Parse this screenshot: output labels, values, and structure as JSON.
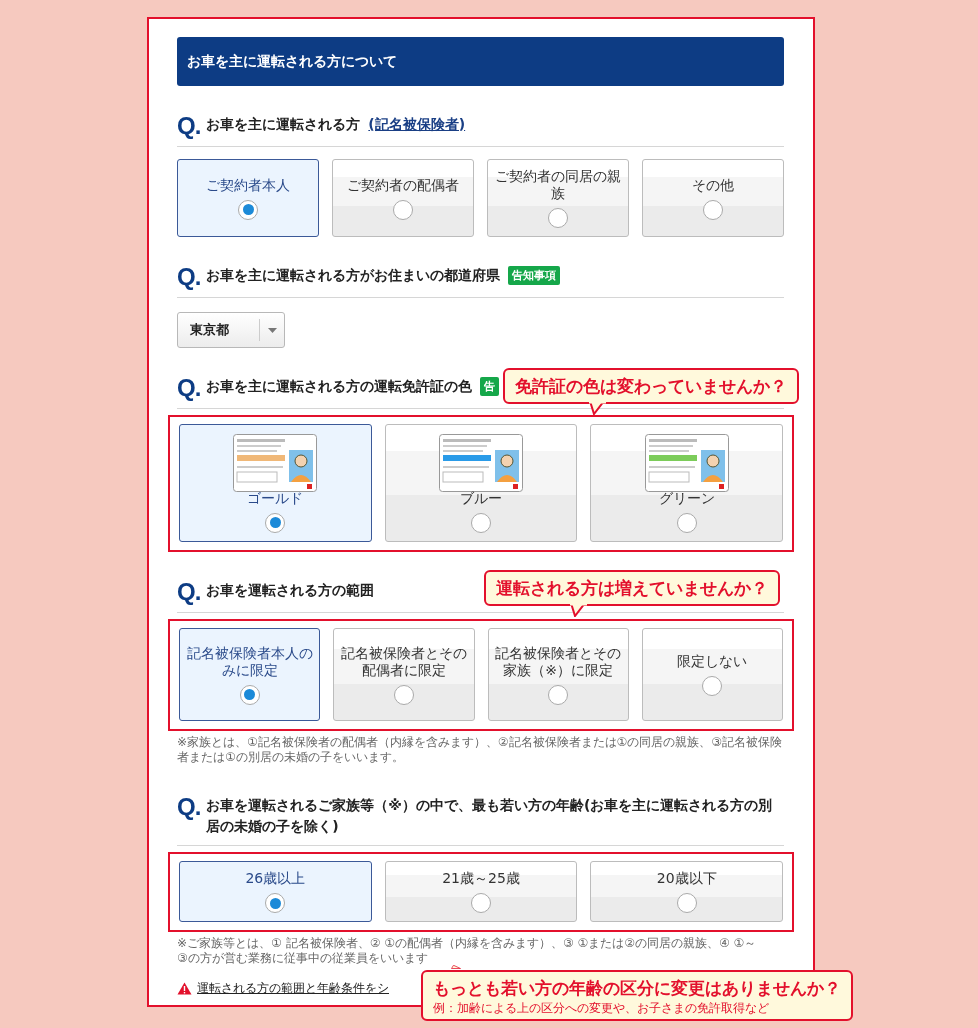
{
  "header": {
    "title": "お車を主に運転される方について"
  },
  "questions": [
    {
      "kind": "choice",
      "q_mark": "Q.",
      "title": "お車を主に運転される方",
      "link": "(記名被保険者)",
      "options": [
        {
          "label": "ご契約者本人",
          "selected": true
        },
        {
          "label": "ご契約者の配偶者",
          "selected": false
        },
        {
          "label": "ご契約者の同居の親族",
          "selected": false
        },
        {
          "label": "その他",
          "selected": false
        }
      ]
    },
    {
      "kind": "select",
      "q_mark": "Q.",
      "title": "お車を主に運転される方がお住まいの都道府県",
      "badge": "告知事項",
      "select": {
        "value": "東京都"
      }
    },
    {
      "kind": "license",
      "q_mark": "Q.",
      "title": "お車を主に運転される方の運転免許証の色",
      "badge": "告",
      "highlighted": true,
      "options": [
        {
          "label": "ゴールド",
          "color": "#f0b878",
          "selected": true
        },
        {
          "label": "ブルー",
          "color": "#2a9be8",
          "selected": false
        },
        {
          "label": "グリーン",
          "color": "#7ccc5a",
          "selected": false
        }
      ]
    },
    {
      "kind": "choice",
      "q_mark": "Q.",
      "title": "お車を運転される方の範囲",
      "highlighted": true,
      "options": [
        {
          "label": "記名被保険者本人のみに限定",
          "selected": true
        },
        {
          "label": "記名被保険者とその配偶者に限定",
          "selected": false
        },
        {
          "label": "記名被保険者とその家族（※）に限定",
          "selected": false
        },
        {
          "label": "限定しない",
          "selected": false
        }
      ],
      "note": "※家族とは、①記名被保険者の配偶者（内縁を含みます）、②記名被保険者または①の同居の親族、③記名被保険者または①の別居の未婚の子をいいます。"
    },
    {
      "kind": "choice",
      "q_mark": "Q.",
      "title": "お車を運転されるご家族等（※）の中で、最も若い方の年齢(お車を主に運転される方の別居の未婚の子を除く)",
      "highlighted": true,
      "options": [
        {
          "label": "26歳以上",
          "selected": true
        },
        {
          "label": "21歳～25歳",
          "selected": false
        },
        {
          "label": "20歳以下",
          "selected": false
        }
      ],
      "note": "※ご家族等とは、① 記名被保険者、② ①の配偶者（内縁を含みます）、③ ①または②の同居の親族、④ ①～③の方が営む業務に従事中の従業員をいいます",
      "warning_link": "運転される方の範囲と年齢条件をシ"
    }
  ],
  "callouts": [
    {
      "title": "免許証の色は変わっていませんか？"
    },
    {
      "title": "運転される方は増えていませんか？"
    },
    {
      "title": "もっとも若い方の年齢の区分に変更はありませんか？",
      "note": "例：加齢による上の区分への変更や、お子さまの免許取得など"
    }
  ]
}
